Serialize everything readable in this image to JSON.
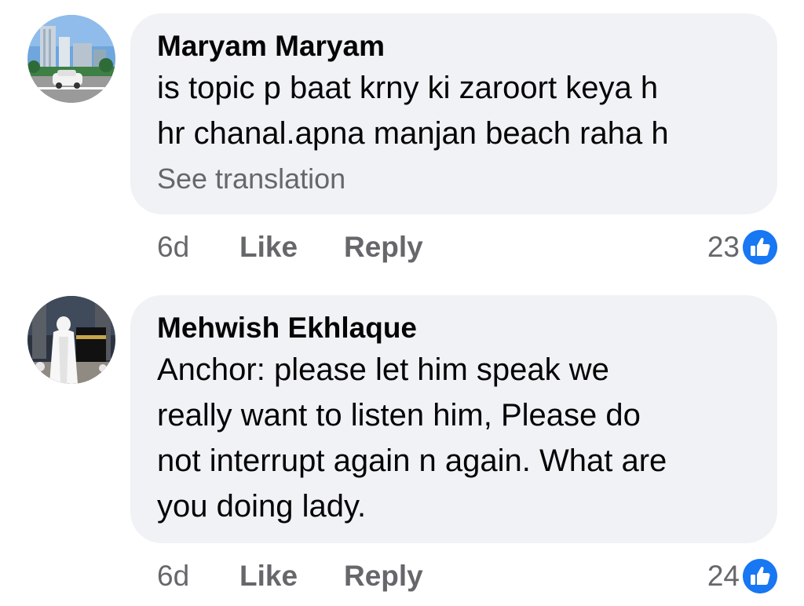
{
  "comments": [
    {
      "author": "Maryam Maryam",
      "text_lines": [
        "is topic p baat krny ki zaroort keya h",
        "hr chanal.apna manjan beach raha h"
      ],
      "see_translation": "See translation",
      "time": "6d",
      "like_label": "Like",
      "reply_label": "Reply",
      "reaction_count": "23",
      "reaction_icon": "thumbs-up-icon",
      "avatar_icon": "city-street-avatar"
    },
    {
      "author": "Mehwish Ekhlaque",
      "text_lines": [
        "Anchor: please let him speak we",
        "really want to listen him, Please do",
        "not interrupt again n again. What are",
        "you doing lady."
      ],
      "time": "6d",
      "like_label": "Like",
      "reply_label": "Reply",
      "reaction_count": "24",
      "reaction_icon": "thumbs-up-icon",
      "avatar_icon": "person-at-kaaba-avatar"
    }
  ],
  "colors": {
    "bubble_bg": "#f0f2f5",
    "secondary_text": "#65676b",
    "primary_text": "#050505",
    "like_blue": "#1877f2"
  }
}
